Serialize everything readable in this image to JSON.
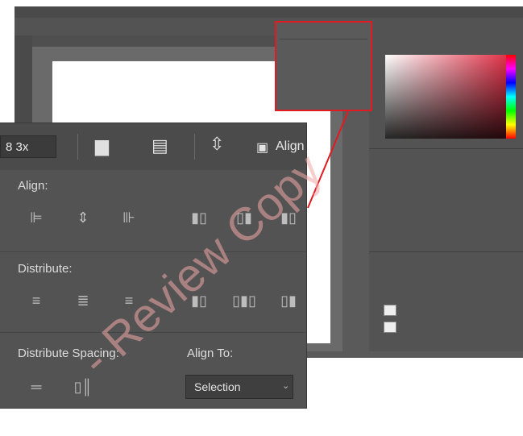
{
  "panel": {
    "field_value": "8 3x",
    "align_toggle_label": "Align",
    "align_section": "Align:",
    "distribute_section": "Distribute:",
    "distribute_spacing_section": "Distribute Spacing:",
    "align_to_label": "Align To:",
    "align_to_value": "Selection",
    "align_icons": [
      "align-left-edges-icon",
      "align-horizontal-centers-icon",
      "align-right-edges-icon",
      "align-top-edges-icon",
      "align-vertical-centers-icon",
      "align-bottom-edges-icon"
    ],
    "distribute_icons": [
      "distribute-top-icon",
      "distribute-vertical-centers-icon",
      "distribute-bottom-icon",
      "distribute-left-icon",
      "distribute-horizontal-centers-icon",
      "distribute-right-icon"
    ],
    "spacing_icons": [
      "distribute-vertical-space-icon",
      "distribute-horizontal-space-icon"
    ]
  },
  "watermark": {
    "text": "- Review Copy"
  },
  "colors": {
    "highlight": "#e11b22",
    "panel_bg": "#535353",
    "canvas": "#ffffff"
  }
}
